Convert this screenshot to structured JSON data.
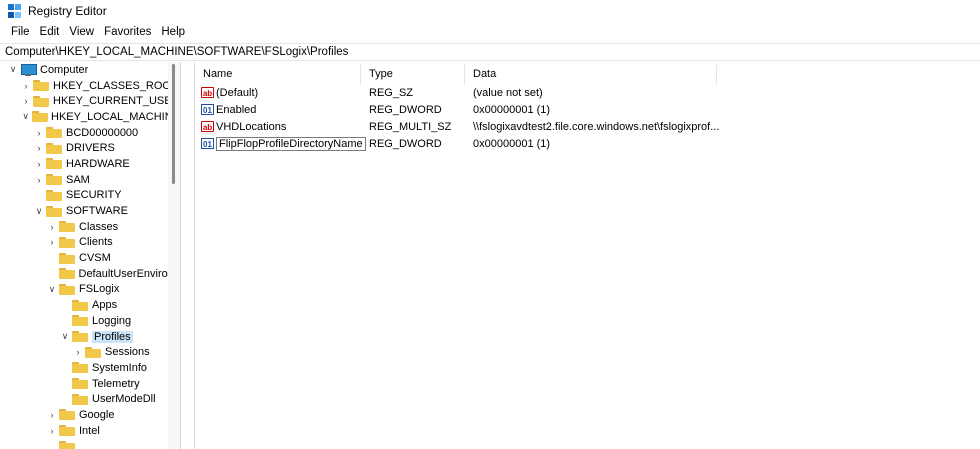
{
  "window": {
    "title": "Registry Editor"
  },
  "menu": [
    "File",
    "Edit",
    "View",
    "Favorites",
    "Help"
  ],
  "address": "Computer\\HKEY_LOCAL_MACHINE\\SOFTWARE\\FSLogix\\Profiles",
  "tree": [
    {
      "label": "Computer",
      "chev": "∨",
      "icon": "computer-icon"
    },
    {
      "label": "HKEY_CLASSES_ROOT",
      "chev": "›",
      "icon": "folder-icon"
    },
    {
      "label": "HKEY_CURRENT_USER",
      "chev": "›",
      "icon": "folder-icon"
    },
    {
      "label": "HKEY_LOCAL_MACHINE",
      "chev": "∨",
      "icon": "folder-icon"
    },
    {
      "label": "BCD00000000",
      "chev": "›",
      "icon": "folder-icon"
    },
    {
      "label": "DRIVERS",
      "chev": "›",
      "icon": "folder-icon"
    },
    {
      "label": "HARDWARE",
      "chev": "›",
      "icon": "folder-icon"
    },
    {
      "label": "SAM",
      "chev": "›",
      "icon": "folder-icon"
    },
    {
      "label": "SECURITY",
      "chev": "",
      "icon": "folder-icon"
    },
    {
      "label": "SOFTWARE",
      "chev": "∨",
      "icon": "folder-icon"
    },
    {
      "label": "Classes",
      "chev": "›",
      "icon": "folder-icon"
    },
    {
      "label": "Clients",
      "chev": "›",
      "icon": "folder-icon"
    },
    {
      "label": "CVSM",
      "chev": "",
      "icon": "folder-icon"
    },
    {
      "label": "DefaultUserEnvironn",
      "chev": "",
      "icon": "folder-icon"
    },
    {
      "label": "FSLogix",
      "chev": "∨",
      "icon": "folder-icon"
    },
    {
      "label": "Apps",
      "chev": "",
      "icon": "folder-icon"
    },
    {
      "label": "Logging",
      "chev": "",
      "icon": "folder-icon"
    },
    {
      "label": "Profiles",
      "chev": "∨",
      "icon": "folder-icon"
    },
    {
      "label": "Sessions",
      "chev": "›",
      "icon": "folder-icon"
    },
    {
      "label": "SystemInfo",
      "chev": "",
      "icon": "folder-icon"
    },
    {
      "label": "Telemetry",
      "chev": "",
      "icon": "folder-icon"
    },
    {
      "label": "UserModeDll",
      "chev": "",
      "icon": "folder-icon"
    },
    {
      "label": "Google",
      "chev": "›",
      "icon": "folder-icon"
    },
    {
      "label": "Intel",
      "chev": "›",
      "icon": "folder-icon"
    },
    {
      "label": "",
      "chev": "",
      "icon": "folder-icon"
    }
  ],
  "list": {
    "headers": {
      "name": "Name",
      "type": "Type",
      "data": "Data"
    },
    "rows": [
      {
        "name": "(Default)",
        "type": "REG_SZ",
        "data": "(value not set)",
        "icon": "ab"
      },
      {
        "name": "Enabled",
        "type": "REG_DWORD",
        "data": "0x00000001 (1)",
        "icon": "bin"
      },
      {
        "name": "VHDLocations",
        "type": "REG_MULTI_SZ",
        "data": "\\\\fslogixavdtest2.file.core.windows.net\\fslogixprof...",
        "icon": "ab"
      },
      {
        "name": "FlipFlopProfileDirectoryName",
        "type": "REG_DWORD",
        "data": "0x00000001 (1)",
        "icon": "bin"
      }
    ]
  }
}
